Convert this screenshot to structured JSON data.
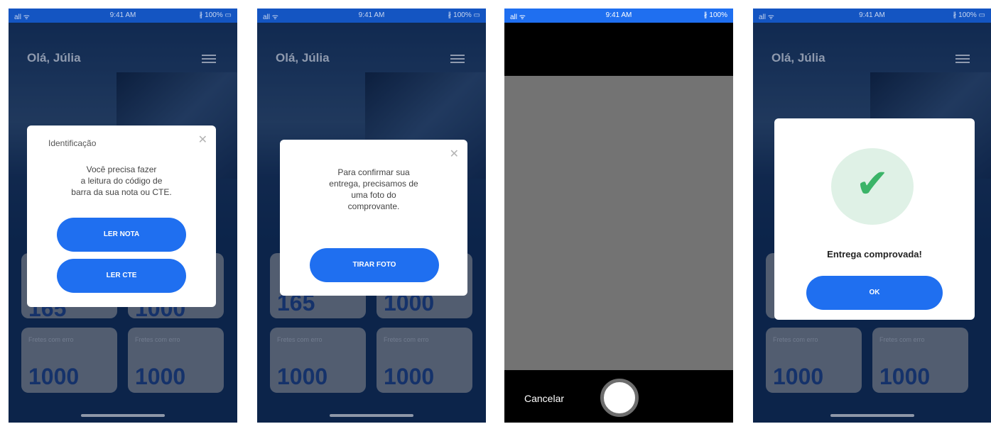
{
  "status_bar": {
    "signal": "all ᯤ",
    "time": "9:41 AM",
    "battery": "∦ 100% ▭"
  },
  "header": {
    "greeting": "Olá, Júlia",
    "menu_icon": "hamburger-icon"
  },
  "cards": [
    {
      "label": "Fretes com erro",
      "value": "1000"
    },
    {
      "label": "Fretes com erro",
      "value": "1000"
    }
  ],
  "partial_values": {
    "left": "165",
    "right": "1000"
  },
  "modal_identificacao": {
    "title": "Identificação",
    "text_line1": "Você precisa fazer",
    "text_line2": "a leitura do código de",
    "text_line3": "barra da sua nota ou CTE.",
    "btn_nota": "LER NOTA",
    "btn_cte": "LER CTE",
    "close": "✕"
  },
  "modal_foto": {
    "text_line1": "Para confirmar sua",
    "text_line2": "entrega, precisamos de",
    "text_line3": "uma foto do",
    "text_line4": "comprovante.",
    "btn": "TIRAR FOTO",
    "close": "✕"
  },
  "camera": {
    "cancel": "Cancelar",
    "time": "9:41 AM",
    "battery": "∦ 100%"
  },
  "modal_sucesso": {
    "text": "Entrega comprovada!",
    "btn": "OK",
    "icon": "✔"
  }
}
